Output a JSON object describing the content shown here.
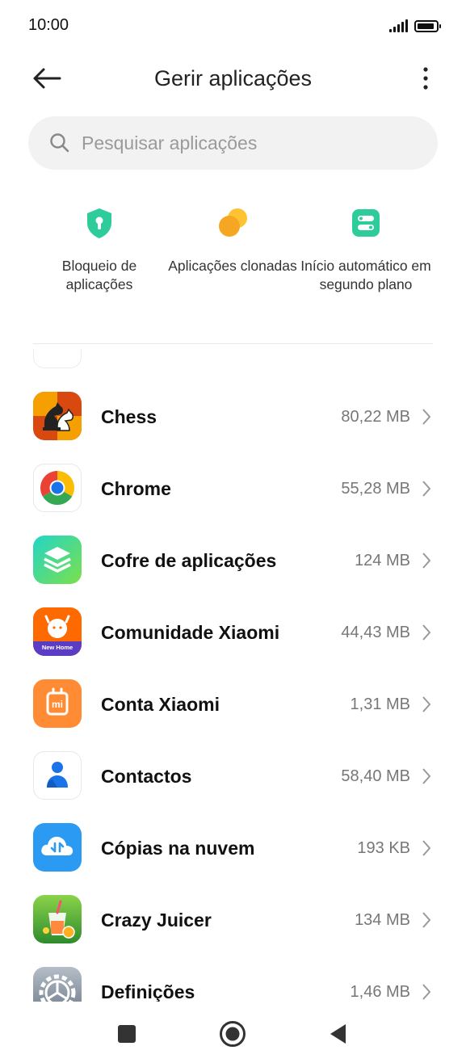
{
  "status_bar": {
    "time": "10:00",
    "signal_icon": "signal-icon",
    "battery_icon": "battery-icon"
  },
  "header": {
    "title": "Gerir aplicações",
    "back_icon": "arrow-left-icon",
    "more_icon": "more-vertical-icon"
  },
  "search": {
    "placeholder": "Pesquisar aplicações",
    "icon": "search-icon"
  },
  "shortcuts": [
    {
      "label": "Bloqueio de aplicações",
      "icon": "app-lock-icon",
      "color": "#2ecc9a"
    },
    {
      "label": "Aplicações clonadas",
      "icon": "dual-apps-icon",
      "color": "#f5a623"
    },
    {
      "label": "Início automático em segundo plano",
      "icon": "autostart-icon",
      "color": "#2ecc9a"
    }
  ],
  "apps": [
    {
      "name": "Chess",
      "size": "80,22 MB",
      "icon": "chess-icon"
    },
    {
      "name": "Chrome",
      "size": "55,28 MB",
      "icon": "chrome-icon"
    },
    {
      "name": "Cofre de aplicações",
      "size": "124 MB",
      "icon": "app-vault-icon"
    },
    {
      "name": "Comunidade Xiaomi",
      "size": "44,43 MB",
      "icon": "xiaomi-community-icon",
      "icon_text": "New Home"
    },
    {
      "name": "Conta Xiaomi",
      "size": "1,31 MB",
      "icon": "xiaomi-account-icon",
      "icon_text": "mi"
    },
    {
      "name": "Contactos",
      "size": "58,40 MB",
      "icon": "contacts-icon"
    },
    {
      "name": "Cópias na nuvem",
      "size": "193 KB",
      "icon": "cloud-backup-icon"
    },
    {
      "name": "Crazy Juicer",
      "size": "134 MB",
      "icon": "crazy-juicer-icon"
    },
    {
      "name": "Definições",
      "size": "1,46 MB",
      "icon": "settings-icon"
    }
  ],
  "nav_bar": {
    "recents_icon": "recents-icon",
    "home_icon": "home-icon",
    "back_icon": "back-triangle-icon"
  }
}
